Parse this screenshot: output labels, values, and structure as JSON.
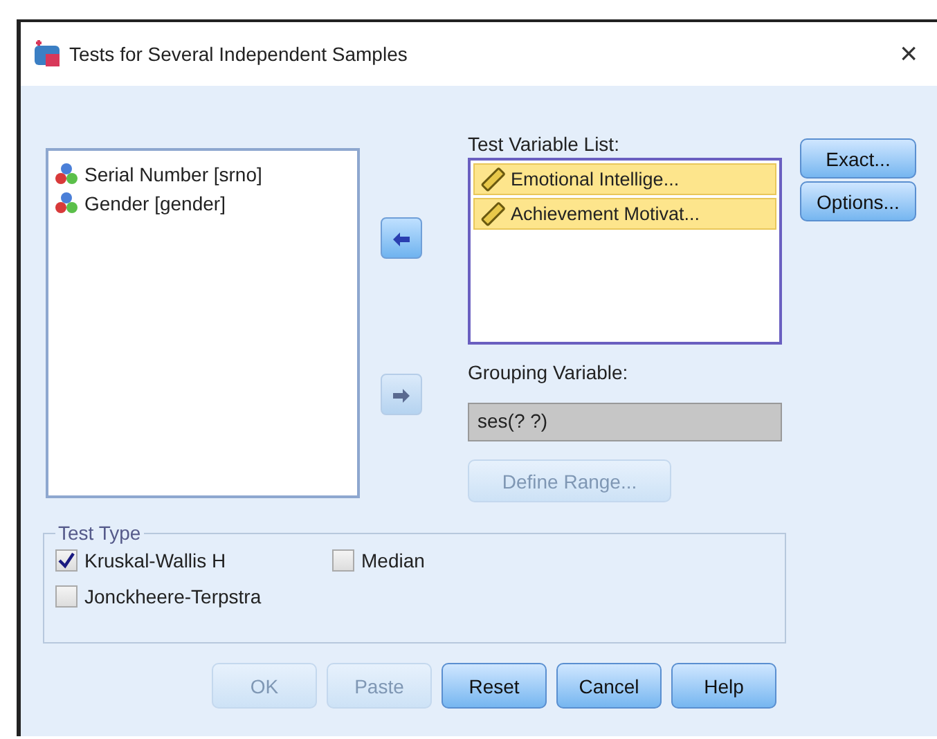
{
  "window": {
    "title": "Tests for Several Independent Samples",
    "close": "×"
  },
  "source_list": {
    "items": [
      {
        "label": "Serial Number  [srno]",
        "kind": "nominal"
      },
      {
        "label": "Gender  [gender]",
        "kind": "nominal"
      }
    ]
  },
  "test_variable_list": {
    "label": "Test Variable List:",
    "items": [
      {
        "label": "Emotional Intellige...",
        "kind": "scale",
        "selected": true
      },
      {
        "label": "Achievement Motivat...",
        "kind": "scale",
        "selected": true
      }
    ]
  },
  "move_buttons": [
    {
      "disabled": false
    },
    {
      "disabled": true
    }
  ],
  "grouping_variable": {
    "label": "Grouping Variable:",
    "value": "ses(? ?)"
  },
  "define_range": {
    "label": "Define Range...",
    "disabled": true
  },
  "side_buttons": [
    {
      "label": "Exact...",
      "disabled": false
    },
    {
      "label": "Options...",
      "disabled": false
    }
  ],
  "test_type": {
    "label": "Test Type",
    "options": [
      {
        "label": "Kruskal-Wallis H",
        "checked": true
      },
      {
        "label": "Median",
        "checked": false
      },
      {
        "label": "Jonckheere-Terpstra",
        "checked": false
      }
    ]
  },
  "buttons": [
    {
      "label": "OK",
      "disabled": true
    },
    {
      "label": "Paste",
      "disabled": true
    },
    {
      "label": "Reset",
      "disabled": false
    },
    {
      "label": "Cancel",
      "disabled": false
    },
    {
      "label": "Help",
      "disabled": false
    }
  ]
}
